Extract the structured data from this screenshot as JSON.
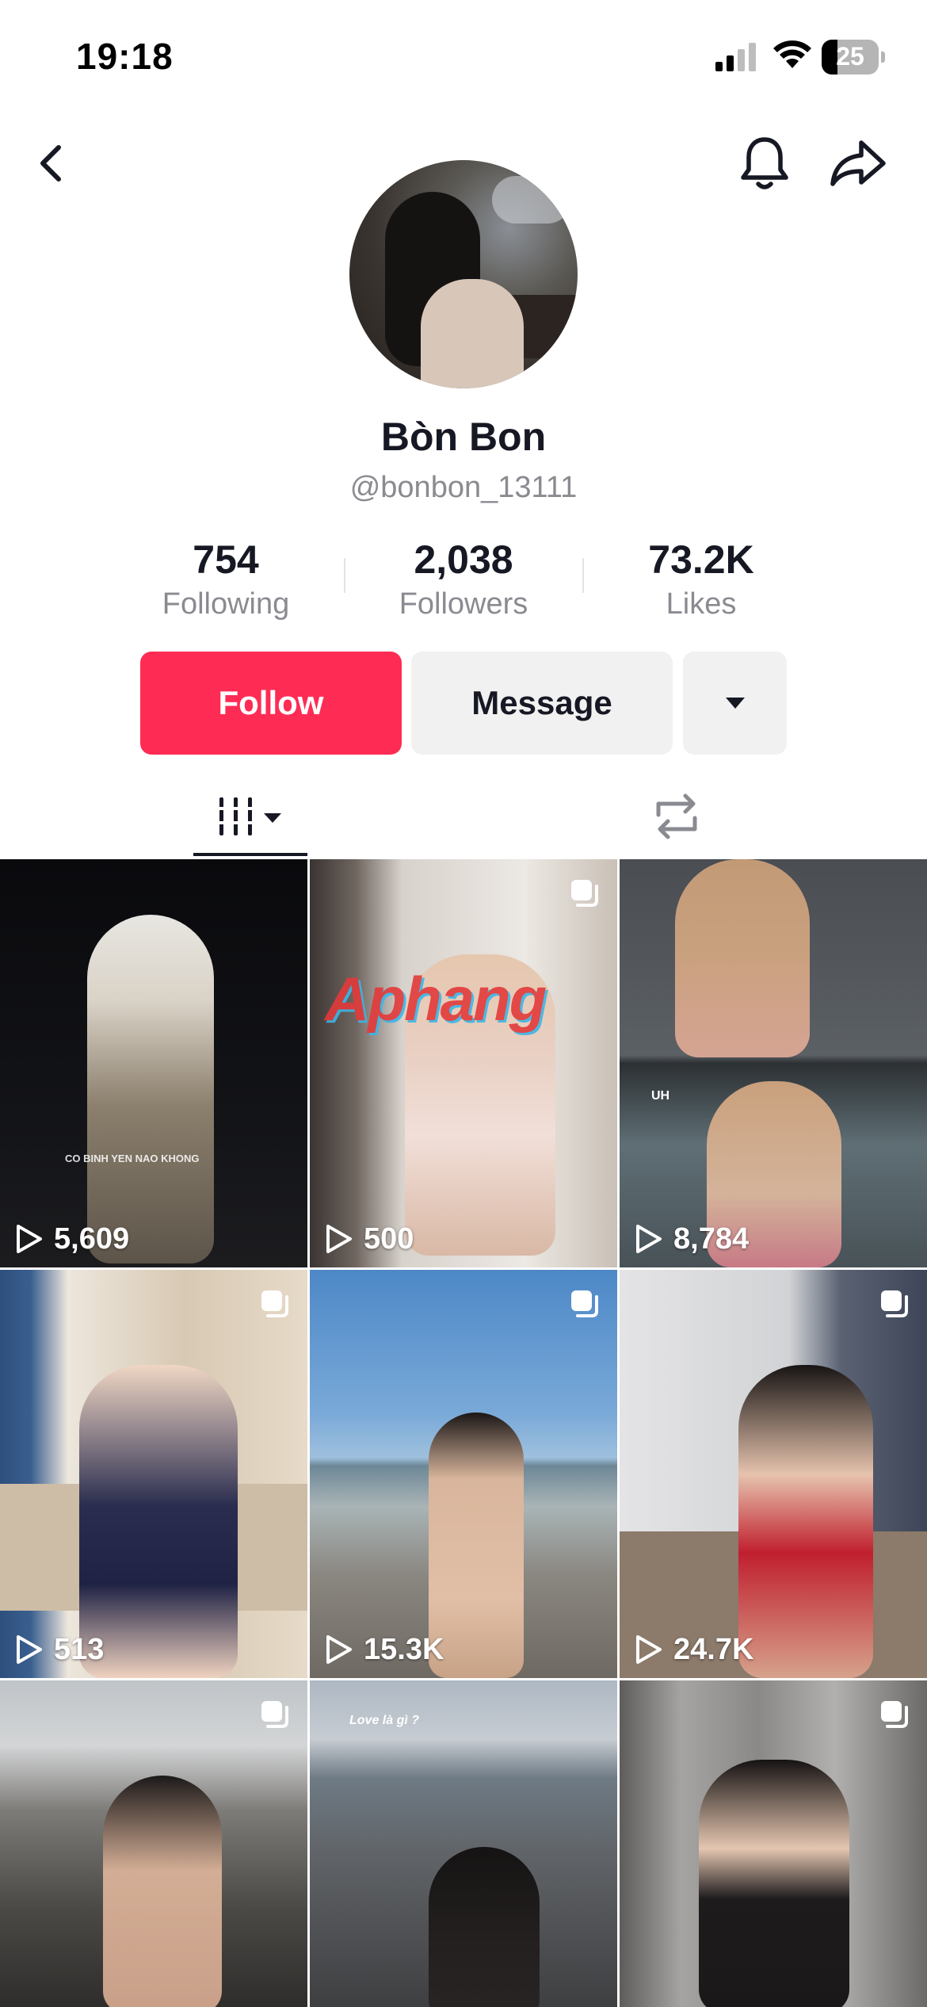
{
  "status_bar": {
    "time": "19:18",
    "battery": "25"
  },
  "profile": {
    "display_name": "Bòn Bon",
    "username": "@bonbon_13111"
  },
  "stats": [
    {
      "value": "754",
      "label": "Following"
    },
    {
      "value": "2,038",
      "label": "Followers"
    },
    {
      "value": "73.2K",
      "label": "Likes"
    }
  ],
  "actions": {
    "follow": "Follow",
    "message": "Message"
  },
  "watermark": "Aphang",
  "videos": [
    {
      "views": "5,609",
      "multi": false,
      "caption": "CO BINH YEN NAO KHONG"
    },
    {
      "views": "500",
      "multi": true,
      "caption": ""
    },
    {
      "views": "8,784",
      "multi": false,
      "caption": "UH"
    },
    {
      "views": "513",
      "multi": true,
      "caption": ""
    },
    {
      "views": "15.3K",
      "multi": true,
      "caption": ""
    },
    {
      "views": "24.7K",
      "multi": true,
      "caption": ""
    },
    {
      "views": "",
      "multi": true,
      "caption": ""
    },
    {
      "views": "",
      "multi": false,
      "caption": "Love là gì ?"
    },
    {
      "views": "",
      "multi": true,
      "caption": ""
    }
  ],
  "colors": {
    "accent": "#fe2c55",
    "text": "#161823",
    "muted": "#8a8b91",
    "button_bg": "#f1f1f2"
  }
}
